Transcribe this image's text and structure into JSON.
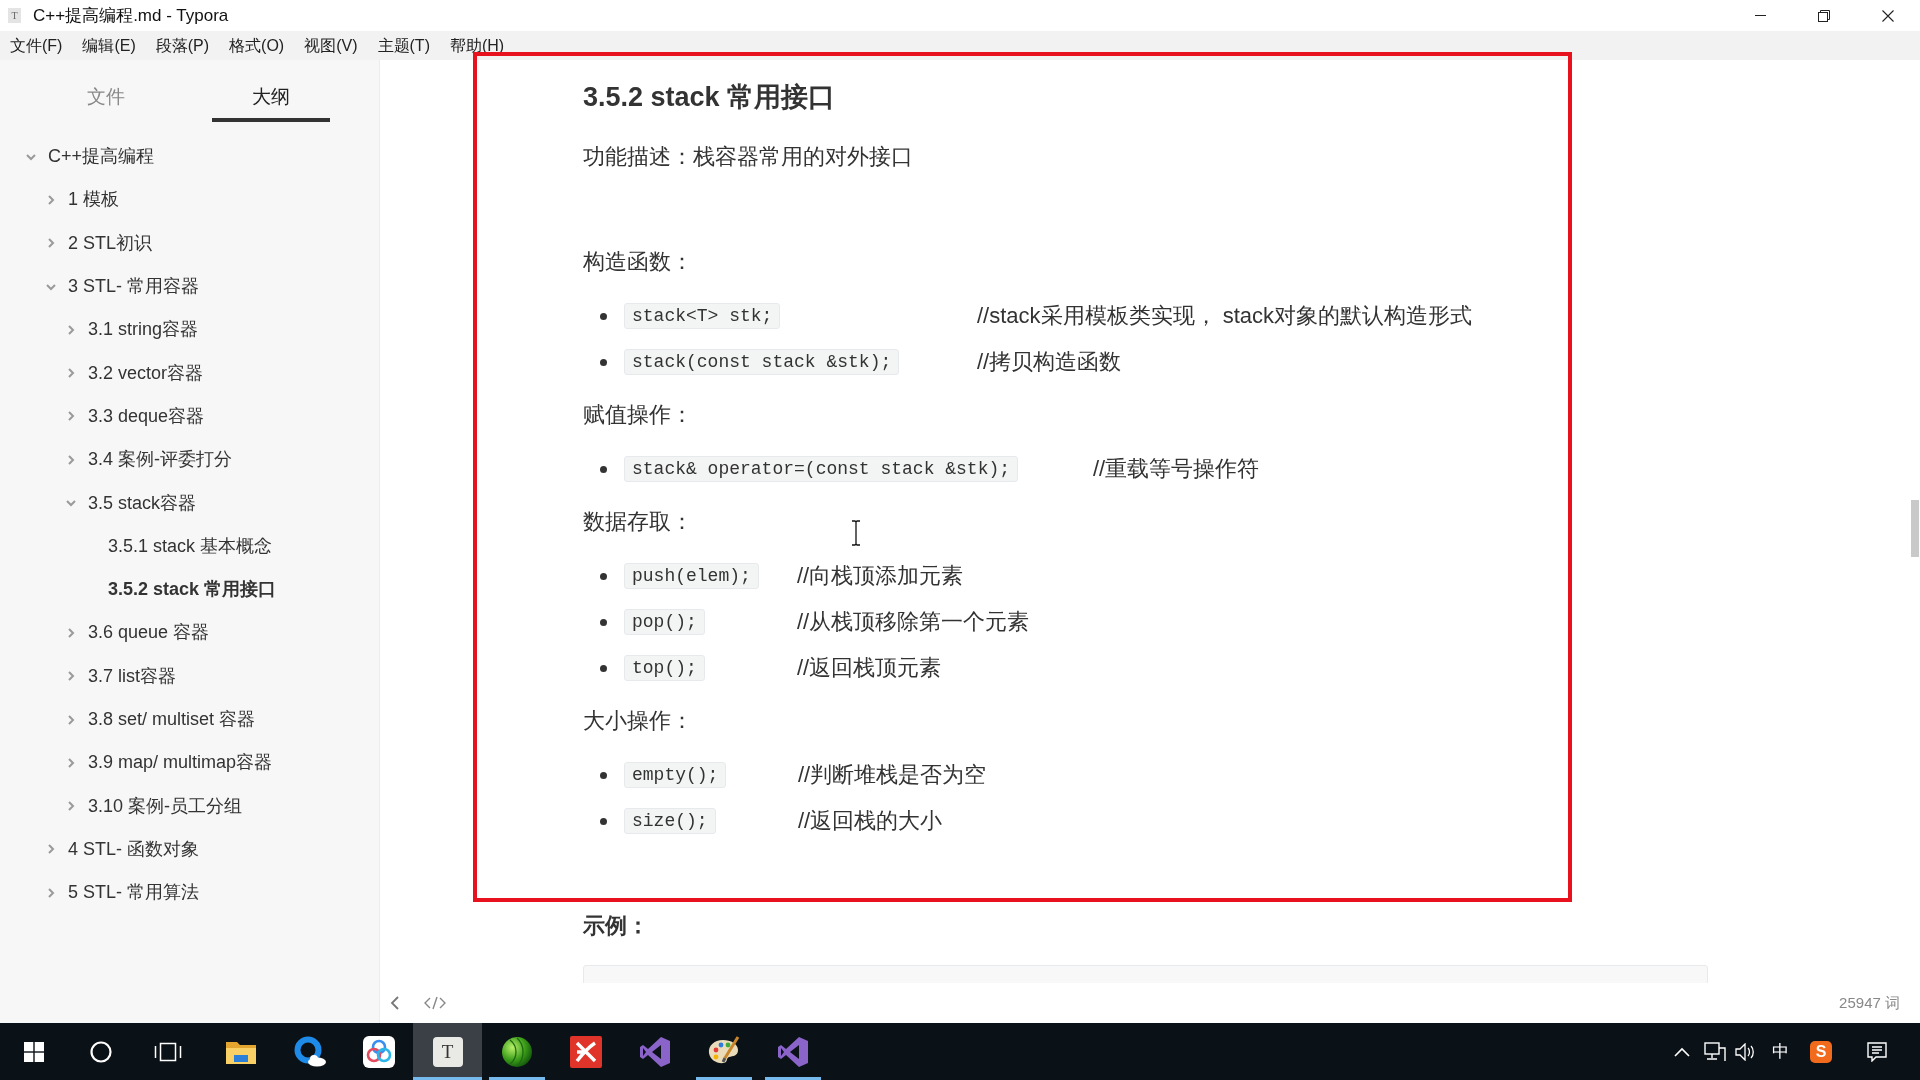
{
  "window": {
    "title": "C++提高编程.md - Typora",
    "icon_glyph": "T"
  },
  "menu": [
    "文件(F)",
    "编辑(E)",
    "段落(P)",
    "格式(O)",
    "视图(V)",
    "主题(T)",
    "帮助(H)"
  ],
  "sidebar": {
    "tabs": [
      {
        "label": "文件",
        "selected": false
      },
      {
        "label": "大纲",
        "selected": true
      }
    ],
    "outline": [
      {
        "label": "C++提高编程",
        "expanded": true,
        "selected": false,
        "children": [
          {
            "label": "1 模板",
            "expanded": false,
            "selected": false
          },
          {
            "label": "2 STL初识",
            "expanded": false,
            "selected": false
          },
          {
            "label": "3 STL- 常用容器",
            "expanded": true,
            "selected": false,
            "children": [
              {
                "label": "3.1 string容器",
                "expanded": false,
                "selected": false
              },
              {
                "label": "3.2 vector容器",
                "expanded": false,
                "selected": false
              },
              {
                "label": "3.3 deque容器",
                "expanded": false,
                "selected": false
              },
              {
                "label": "3.4 案例-评委打分",
                "expanded": false,
                "selected": false
              },
              {
                "label": "3.5 stack容器",
                "expanded": true,
                "selected": false,
                "children": [
                  {
                    "label": "3.5.1 stack 基本概念",
                    "selected": false
                  },
                  {
                    "label": "3.5.2 stack 常用接口",
                    "selected": true
                  }
                ]
              },
              {
                "label": "3.6 queue 容器",
                "expanded": false,
                "selected": false
              },
              {
                "label": "3.7 list容器",
                "expanded": false,
                "selected": false
              },
              {
                "label": "3.8 set/ multiset 容器",
                "expanded": false,
                "selected": false
              },
              {
                "label": "3.9 map/ multimap容器",
                "expanded": false,
                "selected": false
              },
              {
                "label": "3.10 案例-员工分组",
                "expanded": false,
                "selected": false
              }
            ]
          },
          {
            "label": "4 STL- 函数对象",
            "expanded": false,
            "selected": false
          },
          {
            "label": "5 STL- 常用算法",
            "expanded": false,
            "selected": false
          }
        ]
      }
    ]
  },
  "document": {
    "heading": "3.5.2 stack 常用接口",
    "blocks": [
      {
        "kind": "paragraph",
        "text": "功能描述：栈容器常用的对外接口"
      },
      {
        "kind": "paragraph",
        "text": "构造函数："
      },
      {
        "kind": "list",
        "items": [
          {
            "code": "stack<T> stk;",
            "comment": "//stack采用模板类实现， stack对象的默认构造形式"
          },
          {
            "code": "stack(const stack &stk);",
            "comment": "//拷贝构造函数"
          }
        ]
      },
      {
        "kind": "paragraph",
        "text": "赋值操作："
      },
      {
        "kind": "list",
        "items": [
          {
            "code": "stack& operator=(const stack &stk);",
            "comment": "//重载等号操作符"
          }
        ]
      },
      {
        "kind": "paragraph",
        "text": "数据存取："
      },
      {
        "kind": "list",
        "items": [
          {
            "code": "push(elem);",
            "comment": "//向栈顶添加元素"
          },
          {
            "code": "pop();",
            "comment": "//从栈顶移除第一个元素"
          },
          {
            "code": "top();",
            "comment": "//返回栈顶元素"
          }
        ]
      },
      {
        "kind": "paragraph",
        "text": "大小操作："
      },
      {
        "kind": "list",
        "items": [
          {
            "code": "empty();",
            "comment": "//判断堆栈是否为空"
          },
          {
            "code": "size();",
            "comment": "//返回栈的大小"
          }
        ]
      },
      {
        "kind": "strong",
        "text": "示例："
      },
      {
        "kind": "code_block"
      }
    ]
  },
  "status_bar": {
    "word_count": "25947 词"
  },
  "annotation": {
    "frame": true
  },
  "taskbar": {
    "apps": [
      {
        "running": false,
        "selected": false
      },
      {
        "running": false,
        "selected": false
      },
      {
        "running": false,
        "selected": false
      },
      {
        "glyph": "T",
        "running": true,
        "selected": true
      },
      {
        "running": true,
        "selected": false
      },
      {
        "running": false,
        "selected": false
      },
      {
        "running": false,
        "selected": false
      },
      {
        "running": true,
        "selected": false
      },
      {
        "running": true,
        "selected": false
      }
    ],
    "tray": {
      "input_mode": "中",
      "ime_logo": "S"
    }
  }
}
